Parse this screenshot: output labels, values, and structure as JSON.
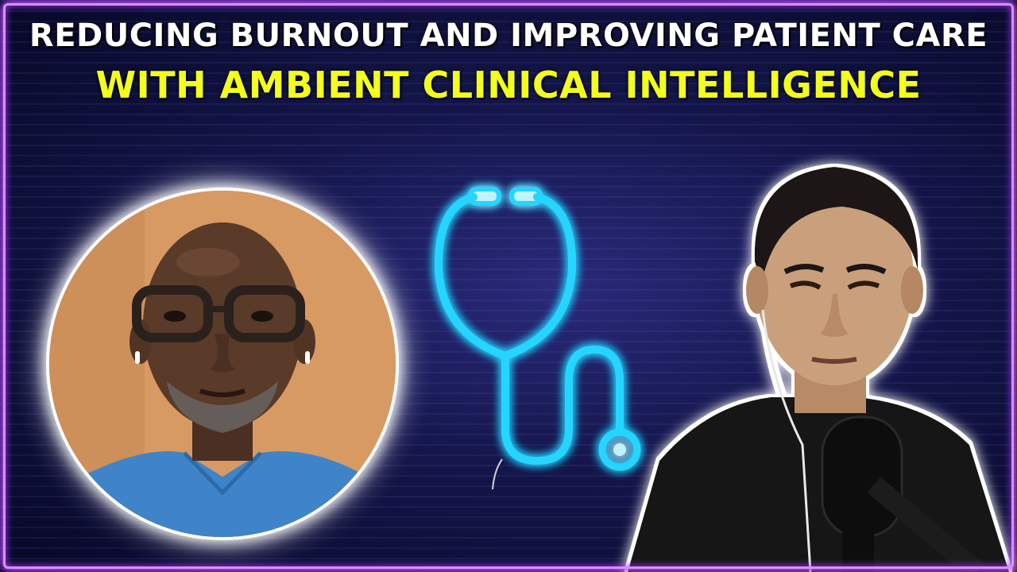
{
  "title": {
    "line1": "REDUCING BURNOUT AND IMPROVING PATIENT CARE",
    "line2": "WITH AMBIENT CLINICAL INTELLIGENCE"
  },
  "colors": {
    "title_primary": "#ffffff",
    "title_accent": "#f3ff1a",
    "neon_frame": "#e08bff",
    "neon_icon": "#27d5ff",
    "background_dark": "#070826"
  },
  "icons": {
    "center": "stethoscope-icon"
  }
}
